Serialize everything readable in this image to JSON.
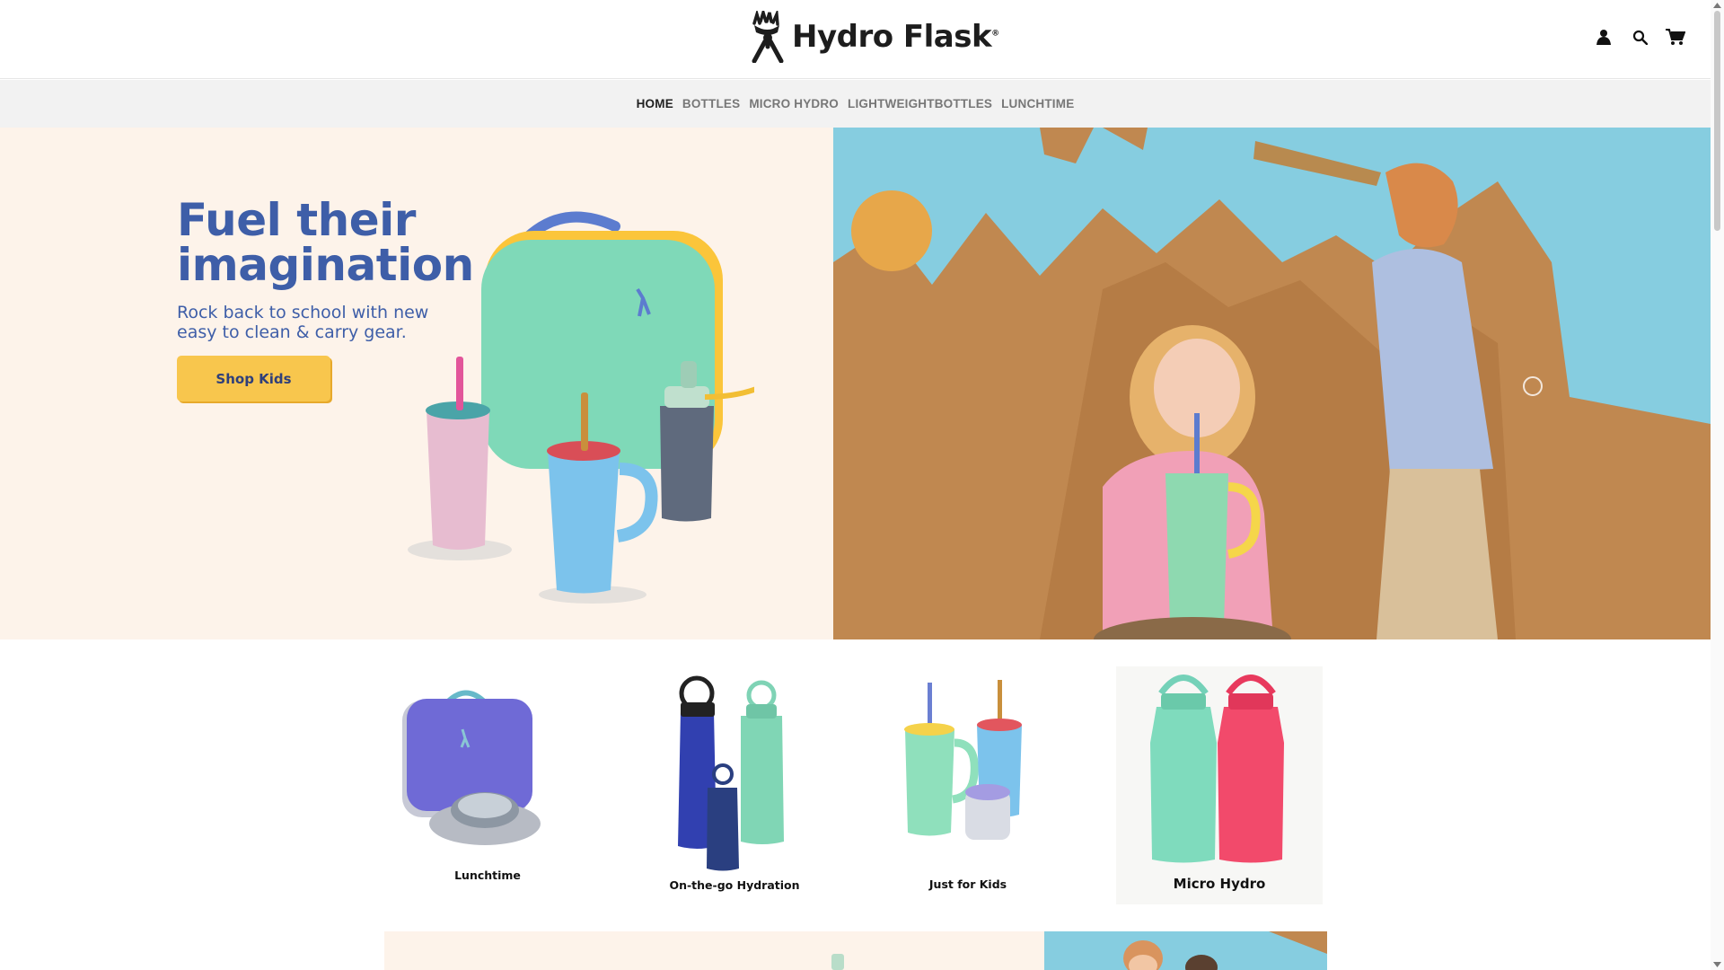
{
  "header": {
    "brand": "Hydro Flask",
    "brand_mark": "®",
    "icons": [
      "account-icon",
      "search-icon",
      "cart-icon"
    ]
  },
  "nav": {
    "items": [
      {
        "label": "HOME",
        "active": true
      },
      {
        "label": "BOTTLES",
        "active": false
      },
      {
        "label": "MICRO HYDRO",
        "active": false
      },
      {
        "label": "LIGHTWEIGHTBOTTLES",
        "active": false
      },
      {
        "label": "LUNCHTIME",
        "active": false
      }
    ]
  },
  "hero": {
    "title": "Fuel their imagination",
    "subtitle": "Rock back to school with new easy to clean & carry gear.",
    "cta": "Shop Kids"
  },
  "categories": [
    {
      "label": "Lunchtime"
    },
    {
      "label": "On-the-go Hydration"
    },
    {
      "label": "Just for Kids"
    },
    {
      "label": "Micro Hydro"
    }
  ],
  "colors": {
    "hero_text": "#3e5ea8",
    "cta_bg": "#f8c64d",
    "hero_left_bg": "#fdf3ea",
    "hero_right_bg": "#86cde0"
  }
}
